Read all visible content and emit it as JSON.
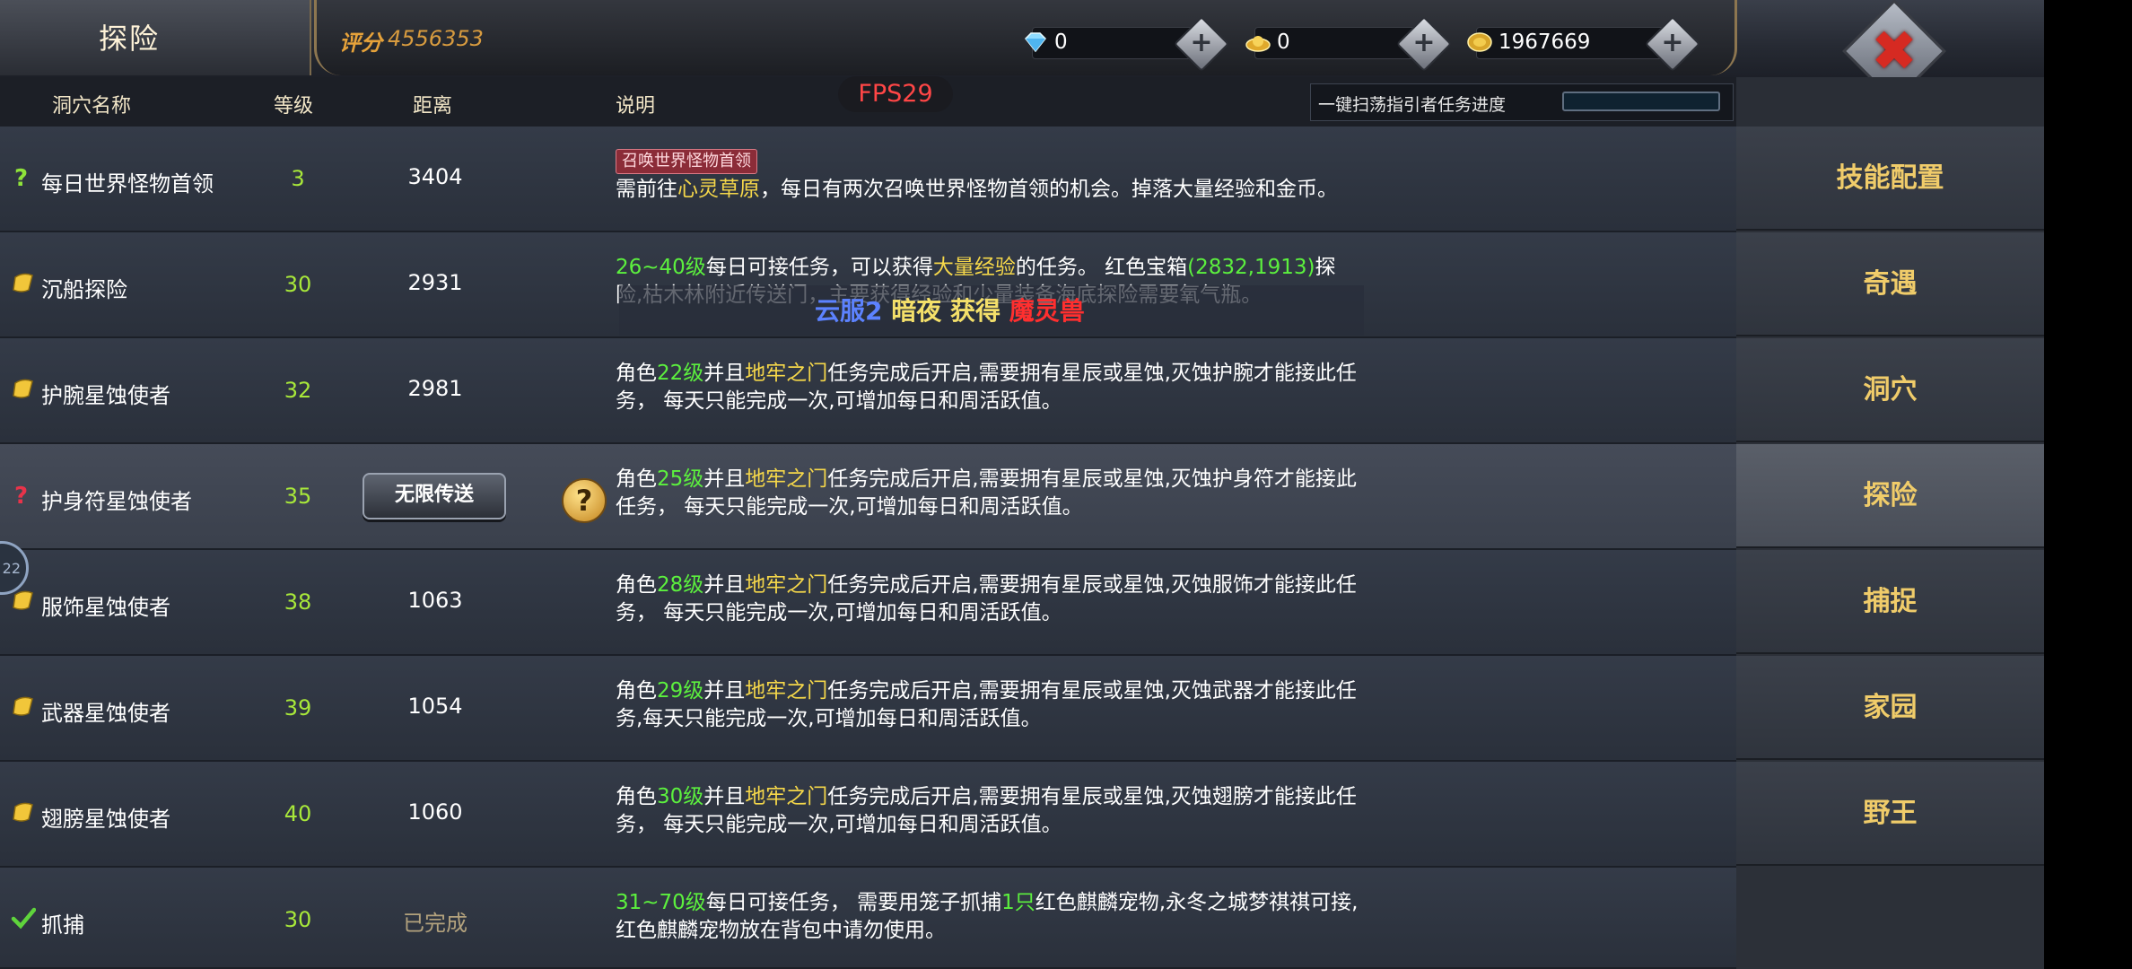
{
  "header": {
    "title": "探险",
    "score_label": "评分",
    "score_value": "4556353",
    "resources": [
      {
        "icon": "diamond-icon",
        "value": "0"
      },
      {
        "icon": "gold-ingot-icon",
        "value": "0"
      },
      {
        "icon": "gold-coin-icon",
        "value": "1967669"
      }
    ],
    "plus_label": "+",
    "close_label": "✖"
  },
  "columns": {
    "name": "洞穴名称",
    "level": "等级",
    "distance": "距离",
    "desc": "说明"
  },
  "fps": "FPS29",
  "sweep": {
    "label": "一键扫荡指引者任务进度",
    "progress": 0
  },
  "rows": [
    {
      "icon": "question-mark-green-icon",
      "name": "每日世界怪物首领",
      "level": "3",
      "distance": "3404",
      "badge": "召唤世界怪物首领",
      "desc_a": "需前往",
      "desc_b": "心灵草原",
      "desc_c": "，每日有两次召唤世界怪物首领的机会。掉落大量经验和金币。"
    },
    {
      "icon": "scroll-icon",
      "name": "沉船探险",
      "level": "30",
      "distance": "2931",
      "desc_a": "26~40级",
      "desc_b": "每日可接任务，可以获得",
      "desc_c": "大量经验",
      "desc_d": "的任务。 红色宝箱",
      "desc_e": "(2832,1913)",
      "desc_f": "探险,枯木林附近传送门，主要获得经验和少量装备海底探险需要氧气瓶。"
    },
    {
      "icon": "scroll-icon",
      "name": "护腕星蚀使者",
      "level": "32",
      "distance": "2981",
      "desc_a": "角色",
      "desc_b": "22级",
      "desc_c": "并且",
      "desc_d": "地牢之门",
      "desc_e": "任务完成后开启,需要拥有星辰或星蚀,灭蚀护腕才能接此任务， 每天只能完成一次,可增加每日和周活跃值。"
    },
    {
      "icon": "question-mark-red-icon",
      "name": "护身符星蚀使者",
      "level": "35",
      "teleport": "无限传送",
      "help": "?",
      "desc_a": "角色",
      "desc_b": "25级",
      "desc_c": "并且",
      "desc_d": "地牢之门",
      "desc_e": "任务完成后开启,需要拥有星辰或星蚀,灭蚀护身符才能接此任务， 每天只能完成一次,可增加每日和周活跃值。"
    },
    {
      "icon": "scroll-icon",
      "name": "服饰星蚀使者",
      "level": "38",
      "distance": "1063",
      "desc_a": "角色",
      "desc_b": "28级",
      "desc_c": "并且",
      "desc_d": "地牢之门",
      "desc_e": "任务完成后开启,需要拥有星辰或星蚀,灭蚀服饰才能接此任务， 每天只能完成一次,可增加每日和周活跃值。"
    },
    {
      "icon": "scroll-icon",
      "name": "武器星蚀使者",
      "level": "39",
      "distance": "1054",
      "desc_a": "角色",
      "desc_b": "29级",
      "desc_c": "并且",
      "desc_d": "地牢之门",
      "desc_e": "任务完成后开启,需要拥有星辰或星蚀,灭蚀武器才能接此任务,每天只能完成一次,可增加每日和周活跃值。"
    },
    {
      "icon": "scroll-icon",
      "name": "翅膀星蚀使者",
      "level": "40",
      "distance": "1060",
      "desc_a": "角色",
      "desc_b": "30级",
      "desc_c": "并且",
      "desc_d": "地牢之门",
      "desc_e": "任务完成后开启,需要拥有星辰或星蚀,灭蚀翅膀才能接此任务， 每天只能完成一次,可增加每日和周活跃值。"
    },
    {
      "icon": "checkmark-icon",
      "name": "抓捕",
      "level": "30",
      "distance": "已完成",
      "desc_a": "31~70级",
      "desc_b": "每日可接任务， 需要用笼子抓捕",
      "desc_c": "1只",
      "desc_d": "红色麒麟宠物,永冬之城梦祺祺可接,红色麒麟宠物放在背包中请勿使用。"
    }
  ],
  "sidebar": [
    "技能配置",
    "奇遇",
    "洞穴",
    "探险",
    "捕捉",
    "家园",
    "野王"
  ],
  "notice": {
    "a": "云服2",
    "b": "暗夜",
    "c": "获得",
    "d": "魔灵兽"
  },
  "bubble": "22",
  "colors": {
    "green": "#5cf03e",
    "yellow": "#f5d74a",
    "red": "#ff2f2f",
    "gold": "#f0cc6a"
  }
}
